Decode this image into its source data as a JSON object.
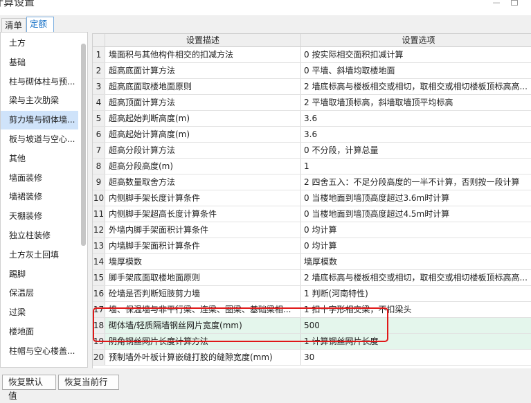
{
  "window": {
    "title": "计算设置",
    "min_glyph": "—",
    "max_glyph": ""
  },
  "tabs": [
    {
      "label": "清单"
    },
    {
      "label": "定额"
    }
  ],
  "sidebar": {
    "items": [
      {
        "label": "土方"
      },
      {
        "label": "基础"
      },
      {
        "label": "柱与砌体柱与预..."
      },
      {
        "label": "梁与主次肋梁"
      },
      {
        "label": "剪力墙与砌体墙..."
      },
      {
        "label": "板与坡道与空心..."
      },
      {
        "label": "其他"
      },
      {
        "label": "墙面装修"
      },
      {
        "label": "墙裙装修"
      },
      {
        "label": "天棚装修"
      },
      {
        "label": "独立柱装修"
      },
      {
        "label": "土方灰土回填"
      },
      {
        "label": "踢脚"
      },
      {
        "label": "保温层"
      },
      {
        "label": "过梁"
      },
      {
        "label": "楼地面"
      },
      {
        "label": "柱帽与空心楼盖..."
      }
    ],
    "selected_index": 4
  },
  "table": {
    "headers": {
      "num": "",
      "desc": "设置描述",
      "opt": "设置选项"
    },
    "rows": [
      {
        "num": "1",
        "desc": "墙面积与其他构件相交的扣减方法",
        "opt": "0 按实际相交面积扣减计算"
      },
      {
        "num": "2",
        "desc": "超高底面计算方法",
        "opt": "0 平墙、斜墙均取楼地面"
      },
      {
        "num": "3",
        "desc": "超高底面取楼地面原则",
        "opt": "2 墙底标高与楼板相交或相切，取相交或相切楼板顶标高高..."
      },
      {
        "num": "4",
        "desc": "超高顶面计算方法",
        "opt": "2 平墙取墙顶标高，斜墙取墙顶平均标高"
      },
      {
        "num": "5",
        "desc": "超高起始判断高度(m)",
        "opt": "3.6"
      },
      {
        "num": "6",
        "desc": "超高起始计算高度(m)",
        "opt": "3.6"
      },
      {
        "num": "7",
        "desc": "超高分段计算方法",
        "opt": "0 不分段，计算总量"
      },
      {
        "num": "8",
        "desc": "超高分段高度(m)",
        "opt": "1"
      },
      {
        "num": "9",
        "desc": "超高数量取舍方法",
        "opt": "2 四舍五入：不足分段高度的一半不计算，否则按一段计算"
      },
      {
        "num": "10",
        "desc": "内侧脚手架长度计算条件",
        "opt": "0 当楼地面到墙顶高度超过3.6m时计算"
      },
      {
        "num": "11",
        "desc": "内侧脚手架超高长度计算条件",
        "opt": "0 当楼地面到墙顶高度超过4.5m时计算"
      },
      {
        "num": "12",
        "desc": "外墙内脚手架面积计算条件",
        "opt": "0 均计算"
      },
      {
        "num": "13",
        "desc": "内墙脚手架面积计算条件",
        "opt": "0 均计算"
      },
      {
        "num": "14",
        "desc": "墙厚模数",
        "opt": "墙厚模数"
      },
      {
        "num": "15",
        "desc": "脚手架底面取楼地面原则",
        "opt": "2 墙底标高与楼板相交或相切，取相交或相切楼板顶标高高..."
      },
      {
        "num": "16",
        "desc": "砼墙是否判断短肢剪力墙",
        "opt": "1 判断(河南特性)"
      },
      {
        "num": "17",
        "desc": "墙、保温墙与非平行梁、连梁、圈梁、基础梁相...",
        "opt": "1 扣十字形相交梁，不扣梁头"
      },
      {
        "num": "18",
        "desc": "砌体墙/轻质隔墙钢丝网片宽度(mm)",
        "opt": "500"
      },
      {
        "num": "19",
        "desc": "阴角钢丝网片长度计算方法",
        "opt": "1 计算钢丝网片长度"
      },
      {
        "num": "20",
        "desc": "预制墙外叶板计算嵌缝打胶的缝隙宽度(mm)",
        "opt": "30"
      }
    ],
    "highlighted_rows": [
      18,
      19
    ]
  },
  "buttons": {
    "restore_default": "恢复默认值",
    "restore_row": "恢复当前行"
  },
  "colors": {
    "selected_tab_text": "#1a73c8",
    "selected_sidebar_bg": "#cfe3fa",
    "highlight_row_bg": "#e4f6ec",
    "annotation_box": "#e01818"
  }
}
